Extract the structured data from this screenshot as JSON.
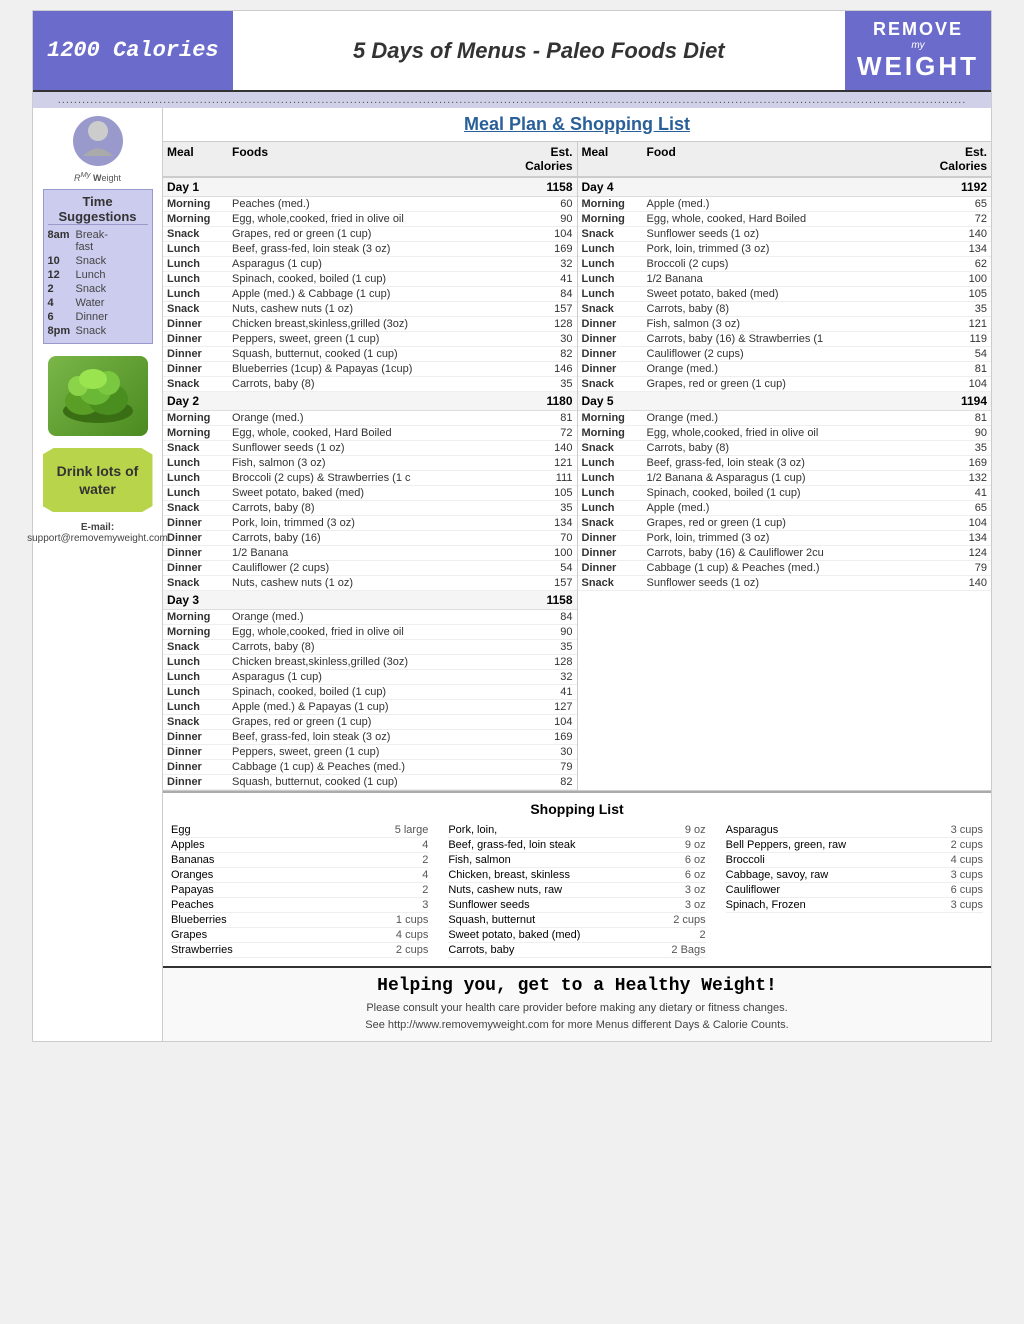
{
  "header": {
    "left_title": "1200 Calories",
    "center_title": "5 Days of Menus - Paleo Foods Diet",
    "right_remove": "REMOVE",
    "right_my": "my",
    "right_weight": "WEIGHT"
  },
  "subtitle": "................................................................................................................................................................................................................................",
  "meal_plan_title": "Meal Plan & Shopping List",
  "col_headers": {
    "meal": "Meal",
    "food": "Foods",
    "food2": "Food",
    "est_cal": "Est. Calories"
  },
  "time_suggestions": {
    "title": "Time Suggestions",
    "rows": [
      {
        "time": "8am",
        "meal": "Breakfast"
      },
      {
        "time": "10",
        "meal": "Snack"
      },
      {
        "time": "12",
        "meal": "Lunch"
      },
      {
        "time": "2",
        "meal": "Snack"
      },
      {
        "time": "4",
        "meal": "Water"
      },
      {
        "time": "6",
        "meal": "Dinner"
      },
      {
        "time": "8pm",
        "meal": "Snack"
      }
    ]
  },
  "drink_text": "Drink lots of water",
  "email_label": "E-mail:",
  "email": "support@removemyweight.com",
  "days": [
    {
      "day": "Day  1",
      "total": "1158",
      "meals": [
        {
          "meal": "Morning",
          "food": "Peaches (med.)",
          "cal": "60"
        },
        {
          "meal": "Morning",
          "food": "Egg, whole,cooked, fried in olive oil",
          "cal": "90"
        },
        {
          "meal": "Snack",
          "food": "Grapes, red or green  (1 cup)",
          "cal": "104"
        },
        {
          "meal": "Lunch",
          "food": "Beef, grass-fed, loin steak (3 oz)",
          "cal": "169"
        },
        {
          "meal": "Lunch",
          "food": "Asparagus (1 cup)",
          "cal": "32"
        },
        {
          "meal": "Lunch",
          "food": "Spinach, cooked, boiled (1 cup)",
          "cal": "41"
        },
        {
          "meal": "Lunch",
          "food": "Apple (med.) & Cabbage  (1 cup)",
          "cal": "84"
        },
        {
          "meal": "Snack",
          "food": "Nuts, cashew nuts (1 oz)",
          "cal": "157"
        },
        {
          "meal": "Dinner",
          "food": "Chicken breast,skinless,grilled (3oz)",
          "cal": "128"
        },
        {
          "meal": "Dinner",
          "food": "Peppers, sweet, green  (1 cup)",
          "cal": "30"
        },
        {
          "meal": "Dinner",
          "food": "Squash, butternut, cooked  (1 cup)",
          "cal": "82"
        },
        {
          "meal": "Dinner",
          "food": "Blueberries (1cup) & Papayas (1cup)",
          "cal": "146"
        },
        {
          "meal": "Snack",
          "food": "Carrots, baby  (8)",
          "cal": "35"
        }
      ]
    },
    {
      "day": "Day  2",
      "total": "1180",
      "meals": [
        {
          "meal": "Morning",
          "food": "Orange (med.)",
          "cal": "81"
        },
        {
          "meal": "Morning",
          "food": "Egg, whole, cooked, Hard Boiled",
          "cal": "72"
        },
        {
          "meal": "Snack",
          "food": "Sunflower seeds (1 oz)",
          "cal": "140"
        },
        {
          "meal": "Lunch",
          "food": "Fish, salmon (3 oz)",
          "cal": "121"
        },
        {
          "meal": "Lunch",
          "food": "Broccoli (2 cups) & Strawberries (1 c",
          "cal": "111"
        },
        {
          "meal": "Lunch",
          "food": "Sweet potato, baked (med)",
          "cal": "105"
        },
        {
          "meal": "Snack",
          "food": "Carrots, baby (8)",
          "cal": "35"
        },
        {
          "meal": "Dinner",
          "food": "Pork, loin, trimmed (3 oz)",
          "cal": "134"
        },
        {
          "meal": "Dinner",
          "food": "Carrots, baby (16)",
          "cal": "70"
        },
        {
          "meal": "Dinner",
          "food": "1/2 Banana",
          "cal": "100"
        },
        {
          "meal": "Dinner",
          "food": "Cauliflower (2 cups)",
          "cal": "54"
        },
        {
          "meal": "Snack",
          "food": "Nuts, cashew nuts (1 oz)",
          "cal": "157"
        }
      ]
    },
    {
      "day": "Day  3",
      "total": "1158",
      "meals": [
        {
          "meal": "Morning",
          "food": "Orange (med.)",
          "cal": "84"
        },
        {
          "meal": "Morning",
          "food": "Egg, whole,cooked, fried in olive oil",
          "cal": "90"
        },
        {
          "meal": "Snack",
          "food": "Carrots, baby (8)",
          "cal": "35"
        },
        {
          "meal": "Lunch",
          "food": "Chicken breast,skinless,grilled (3oz)",
          "cal": "128"
        },
        {
          "meal": "Lunch",
          "food": "Asparagus (1 cup)",
          "cal": "32"
        },
        {
          "meal": "Lunch",
          "food": "Spinach, cooked, boiled (1 cup)",
          "cal": "41"
        },
        {
          "meal": "Lunch",
          "food": "Apple (med.) & Papayas  (1 cup)",
          "cal": "127"
        },
        {
          "meal": "Snack",
          "food": "Grapes, red or green  (1 cup)",
          "cal": "104"
        },
        {
          "meal": "Dinner",
          "food": "Beef, grass-fed, loin steak (3 oz)",
          "cal": "169"
        },
        {
          "meal": "Dinner",
          "food": "Peppers, sweet, green  (1 cup)",
          "cal": "30"
        },
        {
          "meal": "Dinner",
          "food": "Cabbage  (1 cup) & Peaches (med.)",
          "cal": "79"
        },
        {
          "meal": "Dinner",
          "food": "Squash, butternut, cooked  (1 cup)",
          "cal": "82"
        }
      ]
    },
    {
      "day": "Day  4",
      "total": "1192",
      "meals": [
        {
          "meal": "Morning",
          "food": "Apple (med.)",
          "cal": "65"
        },
        {
          "meal": "Morning",
          "food": "Egg, whole, cooked, Hard Boiled",
          "cal": "72"
        },
        {
          "meal": "Snack",
          "food": "Sunflower seeds (1 oz)",
          "cal": "140"
        },
        {
          "meal": "Lunch",
          "food": "Pork, loin, trimmed (3 oz)",
          "cal": "134"
        },
        {
          "meal": "Lunch",
          "food": "Broccoli (2 cups)",
          "cal": "62"
        },
        {
          "meal": "Lunch",
          "food": "1/2 Banana",
          "cal": "100"
        },
        {
          "meal": "Lunch",
          "food": "Sweet potato, baked (med)",
          "cal": "105"
        },
        {
          "meal": "Snack",
          "food": "Carrots, baby  (8)",
          "cal": "35"
        },
        {
          "meal": "Dinner",
          "food": "Fish, salmon (3 oz)",
          "cal": "121"
        },
        {
          "meal": "Dinner",
          "food": "Carrots, baby (16) & Strawberries (1",
          "cal": "119"
        },
        {
          "meal": "Dinner",
          "food": "Cauliflower (2 cups)",
          "cal": "54"
        },
        {
          "meal": "Dinner",
          "food": "Orange (med.)",
          "cal": "81"
        },
        {
          "meal": "Snack",
          "food": "Grapes, red or green  (1 cup)",
          "cal": "104"
        }
      ]
    },
    {
      "day": "Day  5",
      "total": "1194",
      "meals": [
        {
          "meal": "Morning",
          "food": "Orange (med.)",
          "cal": "81"
        },
        {
          "meal": "Morning",
          "food": "Egg, whole,cooked, fried in olive oil",
          "cal": "90"
        },
        {
          "meal": "Snack",
          "food": "Carrots, baby (8)",
          "cal": "35"
        },
        {
          "meal": "Lunch",
          "food": "Beef, grass-fed, loin steak (3 oz)",
          "cal": "169"
        },
        {
          "meal": "Lunch",
          "food": "1/2 Banana & Asparagus (1 cup)",
          "cal": "132"
        },
        {
          "meal": "Lunch",
          "food": "Spinach, cooked, boiled  (1 cup)",
          "cal": "41"
        },
        {
          "meal": "Lunch",
          "food": "Apple (med.)",
          "cal": "65"
        },
        {
          "meal": "Snack",
          "food": "Grapes, red or green  (1 cup)",
          "cal": "104"
        },
        {
          "meal": "Dinner",
          "food": "Pork, loin, trimmed (3 oz)",
          "cal": "134"
        },
        {
          "meal": "Dinner",
          "food": "Carrots, baby (16) & Cauliflower 2cu",
          "cal": "124"
        },
        {
          "meal": "Dinner",
          "food": "Cabbage  (1 cup) & Peaches (med.)",
          "cal": "79"
        },
        {
          "meal": "Snack",
          "food": "Sunflower seeds (1 oz)",
          "cal": "140"
        }
      ]
    }
  ],
  "shopping": {
    "title": "Shopping List",
    "col1": [
      {
        "item": "Egg",
        "qty": "5 large"
      },
      {
        "item": "Apples",
        "qty": "4"
      },
      {
        "item": "Bananas",
        "qty": "2"
      },
      {
        "item": "Oranges",
        "qty": "4"
      },
      {
        "item": "Papayas",
        "qty": "2"
      },
      {
        "item": "Peaches",
        "qty": "3"
      },
      {
        "item": "Blueberries",
        "qty": "1 cups"
      },
      {
        "item": "Grapes",
        "qty": "4 cups"
      },
      {
        "item": "Strawberries",
        "qty": "2 cups"
      }
    ],
    "col2": [
      {
        "item": "Pork, loin,",
        "qty": "9 oz"
      },
      {
        "item": "Beef, grass-fed, loin steak",
        "qty": "9 oz"
      },
      {
        "item": "Fish, salmon",
        "qty": "6 oz"
      },
      {
        "item": "Chicken, breast, skinless",
        "qty": "6 oz"
      },
      {
        "item": "Nuts, cashew nuts, raw",
        "qty": "3 oz"
      },
      {
        "item": "Sunflower seeds",
        "qty": "3 oz"
      },
      {
        "item": "Squash, butternut",
        "qty": "2 cups"
      },
      {
        "item": "Sweet potato, baked (med)",
        "qty": "2"
      },
      {
        "item": "Carrots, baby",
        "qty": "2 Bags"
      }
    ],
    "col3": [
      {
        "item": "Asparagus",
        "qty": "3 cups"
      },
      {
        "item": "Bell Peppers, green, raw",
        "qty": "2 cups"
      },
      {
        "item": "Broccoli",
        "qty": "4 cups"
      },
      {
        "item": "Cabbage, savoy, raw",
        "qty": "3 cups"
      },
      {
        "item": "Cauliflower",
        "qty": "6 cups"
      },
      {
        "item": "Spinach, Frozen",
        "qty": "3 cups"
      }
    ]
  },
  "footer": {
    "main_text": "Helping you, get to a Healthy Weight!",
    "sub1": "Please consult your health care provider before making any dietary or fitness changes.",
    "sub2": "See http://www.removemyweight.com for more Menus different Days & Calorie Counts."
  }
}
